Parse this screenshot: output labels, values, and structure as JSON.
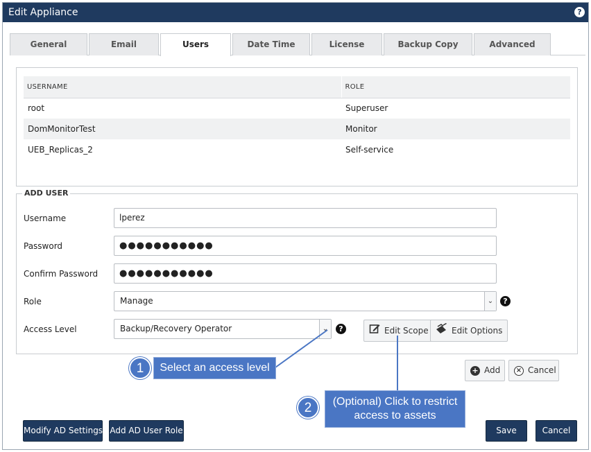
{
  "window": {
    "title": "Edit Appliance"
  },
  "tabs": [
    {
      "label": "General"
    },
    {
      "label": "Email"
    },
    {
      "label": "Users"
    },
    {
      "label": "Date Time"
    },
    {
      "label": "License"
    },
    {
      "label": "Backup Copy"
    },
    {
      "label": "Advanced"
    }
  ],
  "users_table": {
    "headers": [
      "USERNAME",
      "ROLE"
    ],
    "rows": [
      {
        "username": "root",
        "role": "Superuser"
      },
      {
        "username": "DomMonitorTest",
        "role": "Monitor"
      },
      {
        "username": "UEB_Replicas_2",
        "role": "Self-service"
      }
    ]
  },
  "add_user": {
    "legend": "ADD USER",
    "username": {
      "label": "Username",
      "value": "lperez"
    },
    "password": {
      "label": "Password",
      "value": "●●●●●●●●●●●"
    },
    "confirm_password": {
      "label": "Confirm Password",
      "value": "●●●●●●●●●●●"
    },
    "role": {
      "label": "Role",
      "value": "Manage"
    },
    "access_level": {
      "label": "Access Level",
      "value": "Backup/Recovery Operator"
    },
    "edit_scope_label": "Edit Scope",
    "edit_options_label": "Edit Options"
  },
  "actions": {
    "add_label": "Add",
    "cancel_label": "Cancel"
  },
  "footer": {
    "modify_ad_label": "Modify AD Settings",
    "add_ad_role_label": "Add AD User Role",
    "save_label": "Save",
    "cancel_label": "Cancel"
  },
  "callouts": [
    {
      "number": "1",
      "text": "Select an access level"
    },
    {
      "number": "2",
      "text": "(Optional) Click to restrict access to assets"
    }
  ],
  "icons": {
    "help": "question-circle-icon",
    "dropdown": "chevron-down-icon",
    "edit_scope": "pencil-square-icon",
    "edit_options": "gear-edit-icon",
    "add": "plus-circle-icon",
    "cancel": "x-circle-icon"
  },
  "colors": {
    "titlebar": "#1f3a5f",
    "primary_button": "#1f3a5f",
    "callout": "#4a76c4"
  }
}
